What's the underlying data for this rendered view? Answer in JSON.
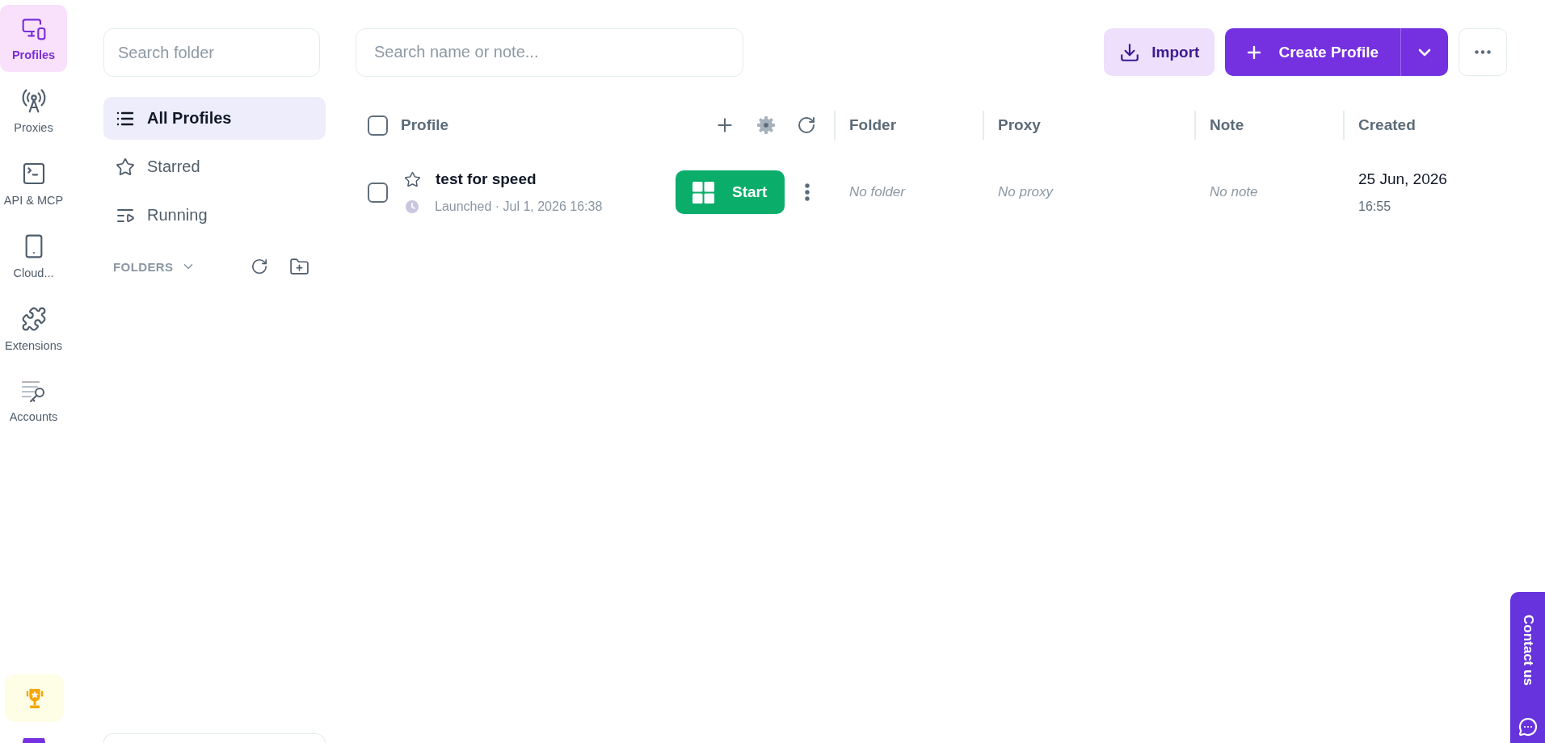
{
  "nav_rail": {
    "items": [
      {
        "label": "Profiles",
        "selected": true
      },
      {
        "label": "Proxies",
        "selected": false
      },
      {
        "label": "API & MCP",
        "selected": false
      },
      {
        "label": "Cloud...",
        "selected": false
      },
      {
        "label": "Extensions",
        "selected": false
      },
      {
        "label": "Accounts",
        "selected": false
      }
    ]
  },
  "folder_panel": {
    "search": {
      "placeholder": "Search folder"
    },
    "items": [
      {
        "label": "All Profiles",
        "selected": true
      },
      {
        "label": "Starred",
        "selected": false
      },
      {
        "label": "Running",
        "selected": false
      }
    ],
    "folders_heading": "FOLDERS"
  },
  "toolbar": {
    "search": {
      "placeholder": "Search name or note..."
    },
    "import_button": "Import",
    "create_button": "Create Profile"
  },
  "table": {
    "select_all_checked": false,
    "columns": [
      "Profile",
      "Folder",
      "Proxy",
      "Note",
      "Created"
    ],
    "rows": [
      {
        "checked": false,
        "starred": false,
        "name": "test for speed",
        "status": "Launched · Jul 1, 2026 16:38",
        "action": "Start",
        "folder": "No folder",
        "proxy": "No proxy",
        "note": "No note",
        "created_date": "25 Jun, 2026",
        "created_time": "16:55"
      }
    ]
  },
  "contact_tab": {
    "label": "Contact us"
  }
}
